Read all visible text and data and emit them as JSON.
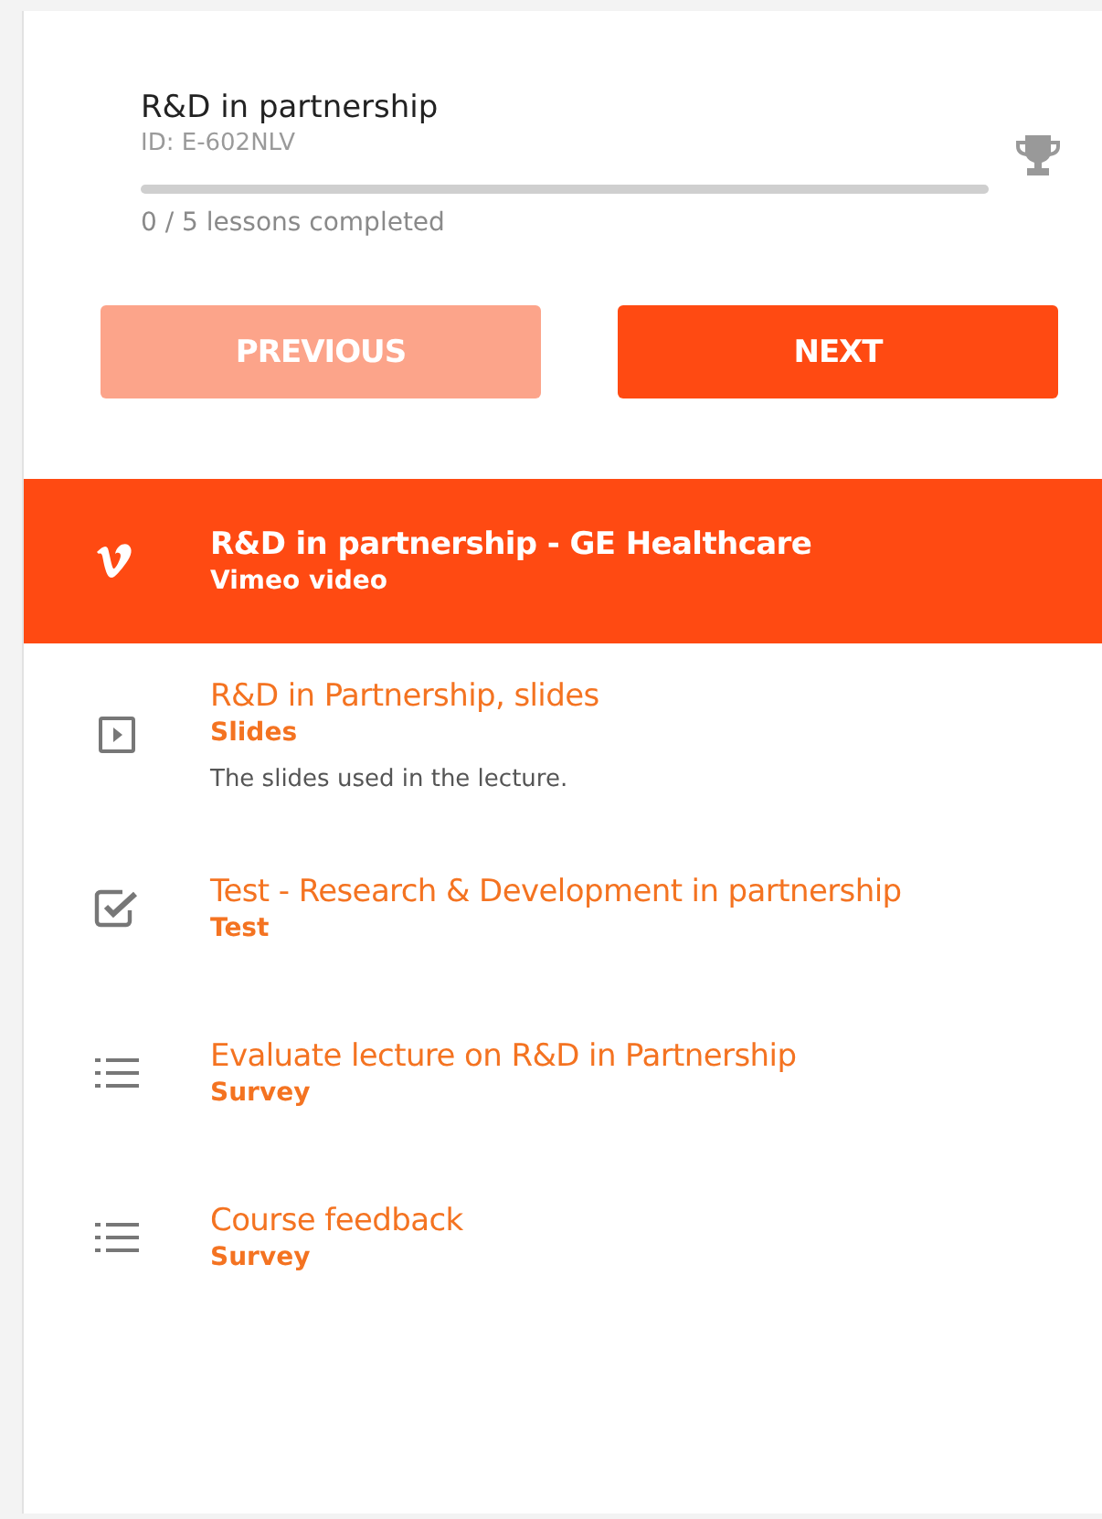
{
  "course": {
    "title": "R&D in partnership",
    "id": "ID: E-602NLV",
    "progress": {
      "level": 0,
      "reading": "0 / 5 lessons completed"
    }
  },
  "buttons": [
    {
      "label": "PREVIOUS",
      "disabled": true
    },
    {
      "label": "NEXT",
      "disabled": false
    }
  ],
  "lessons": [
    {
      "kind": "video",
      "title": "R&D in partnership - GE Healthcare",
      "type": "Vimeo video",
      "selected": true
    },
    {
      "kind": "slides",
      "title": "R&D in Partnership, slides",
      "type": "Slides",
      "description": "The slides used in the lecture.",
      "selected": false
    },
    {
      "kind": "test",
      "title": "Test - Research & Development in partnership",
      "type": "Test",
      "selected": false
    },
    {
      "kind": "survey",
      "title": "Evaluate lecture on R&D in Partnership",
      "type": "Survey",
      "selected": false
    },
    {
      "kind": "survey",
      "title": "Course feedback",
      "type": "Survey",
      "selected": false
    }
  ]
}
